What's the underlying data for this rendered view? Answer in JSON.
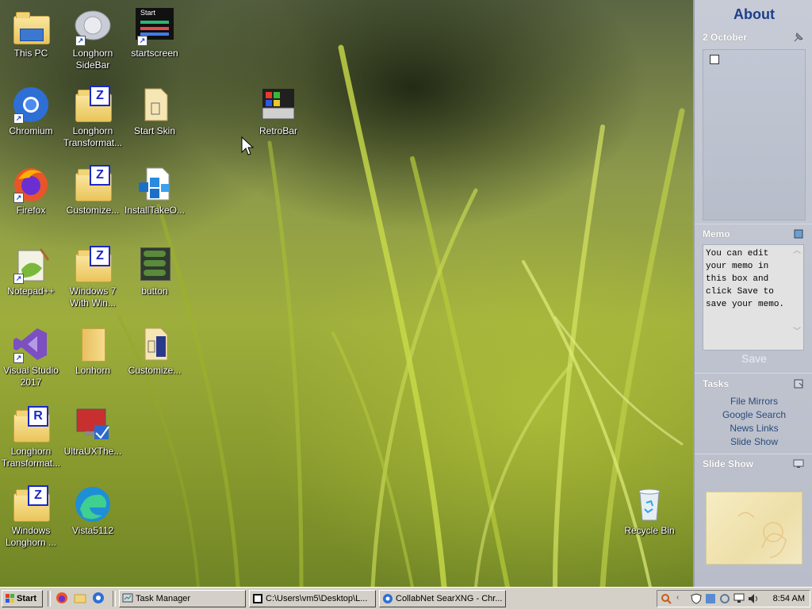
{
  "desktop": {
    "icons": [
      {
        "label": "This PC"
      },
      {
        "label": "Chromium"
      },
      {
        "label": "Firefox"
      },
      {
        "label": "Notepad++"
      },
      {
        "label": "Visual Studio 2017"
      },
      {
        "label": "Longhorn Transformat..."
      },
      {
        "label": "Windows Longhorn ..."
      },
      {
        "label": "Longhorn SideBar"
      },
      {
        "label": "Longhorn Transformat..."
      },
      {
        "label": "Customize..."
      },
      {
        "label": "Windows 7 With Win..."
      },
      {
        "label": "Lonhorn"
      },
      {
        "label": "UltraUXThe..."
      },
      {
        "label": "Vista5112"
      },
      {
        "label": "startscreen"
      },
      {
        "label": "Start Skin"
      },
      {
        "label": "InstallTakeO..."
      },
      {
        "label": "button"
      },
      {
        "label": "Customize..."
      },
      {
        "label": "RetroBar"
      },
      {
        "label": "Recycle Bin"
      }
    ],
    "startscreen_thumb_text": "Start",
    "badge_z": "Z",
    "badge_r": "R"
  },
  "sidebar": {
    "title": "About",
    "calendar": {
      "date": "2 October"
    },
    "memo": {
      "title": "Memo",
      "text": "You can edit your memo in this box and click Save to save your memo.",
      "save_label": "Save"
    },
    "tasks": {
      "title": "Tasks",
      "items": [
        "File Mirrors",
        "Google Search",
        "News Links",
        "Slide Show"
      ]
    },
    "slideshow": {
      "title": "Slide Show"
    }
  },
  "taskbar": {
    "start_label": "Start",
    "windows": [
      {
        "label": "Task Manager"
      },
      {
        "label": "C:\\Users\\vm5\\Desktop\\L..."
      },
      {
        "label": "CollabNet SearXNG - Chr..."
      }
    ],
    "clock": "8:54 AM"
  },
  "colors": {
    "sidebar_title": "#1c3f8c",
    "zbadge": "#1a28c8",
    "taskbar": "#d4d0c8"
  }
}
